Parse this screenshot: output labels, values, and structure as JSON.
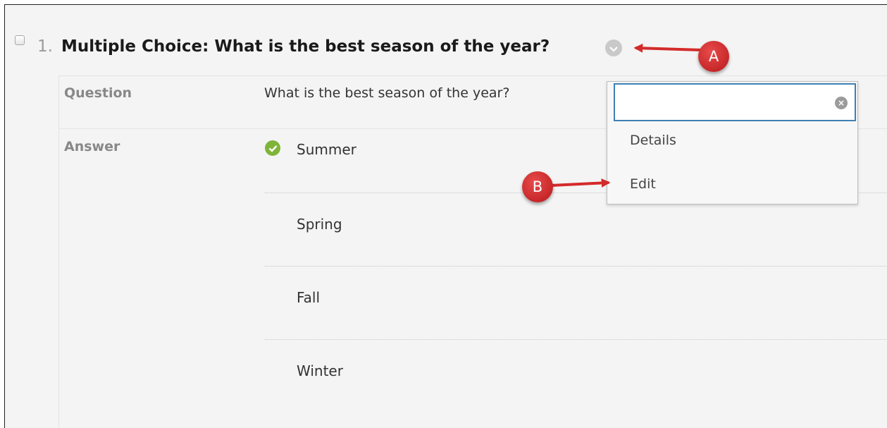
{
  "question": {
    "number": "1.",
    "title": "Multiple Choice: What is the best season of the year?"
  },
  "details": {
    "question_label": "Question",
    "question_text": "What is the best season of the year?",
    "answer_label": "Answer",
    "answers": [
      {
        "text": "Summer",
        "correct": true
      },
      {
        "text": "Spring",
        "correct": false
      },
      {
        "text": "Fall",
        "correct": false
      },
      {
        "text": "Winter",
        "correct": false
      }
    ]
  },
  "menu": {
    "search_value": "",
    "items": [
      "Details",
      "Edit"
    ]
  },
  "annotations": {
    "a_label": "A",
    "b_label": "B"
  },
  "colors": {
    "accent_border": "#3f7fb4",
    "correct_check": "#7fb43a",
    "callout": "#d42a2a"
  }
}
